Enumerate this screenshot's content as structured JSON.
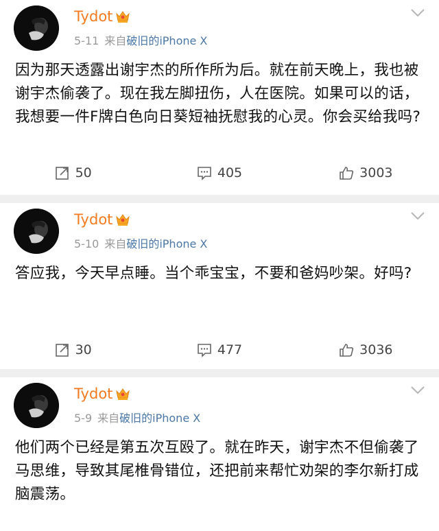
{
  "posts": [
    {
      "username": "Tydot",
      "date": "5-11",
      "from": "来自",
      "device": "破旧的iPhone X",
      "text": "因为那天透露出谢宇杰的所作所为后。就在前天晚上，我也被谢宇杰偷袭了。现在我左脚扭伤，人在医院。如果可以的话，我想要一件F牌白色向日葵短袖抚慰我的心灵。你会买给我吗?",
      "reposts": "50",
      "comments": "405",
      "likes": "3003"
    },
    {
      "username": "Tydot",
      "date": "5-10",
      "from": "来自",
      "device": "破旧的iPhone X",
      "text": "答应我，今天早点睡。当个乖宝宝，不要和爸妈吵架。好吗?",
      "reposts": "30",
      "comments": "477",
      "likes": "3036"
    },
    {
      "username": "Tydot",
      "date": "5-9",
      "from": "来自",
      "device": "破旧的iPhone X",
      "text": "他们两个已经是第五次互殴了。就在昨天，谢宇杰不但偷袭了马思维，导致其尾椎骨错位，还把前来帮忙劝架的李尔新打成脑震荡。"
    }
  ],
  "colors": {
    "username": "#f47a1f",
    "device": "#4a76a8",
    "meta": "#999999",
    "separator": "#efefef"
  },
  "icons": {
    "repost": "repost-icon",
    "comment": "comment-icon",
    "like": "thumbs-up-icon",
    "more": "chevron-down-icon",
    "badge": "vip-crown-icon"
  }
}
